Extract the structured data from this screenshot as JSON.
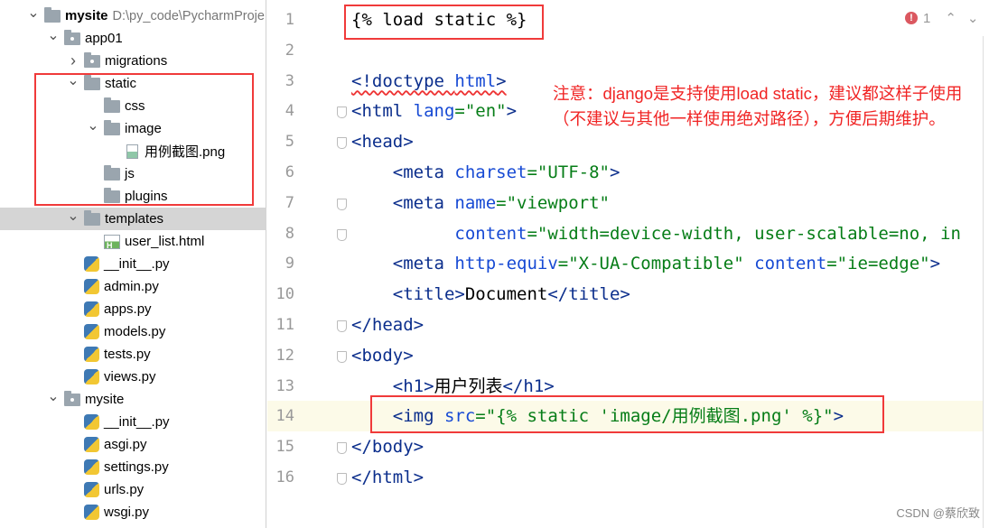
{
  "project_tree": [
    {
      "label": "mysite",
      "path": "D:\\py_code\\PycharmProje",
      "level": 0,
      "chevron": "down",
      "icon": "folder",
      "bold": true
    },
    {
      "label": "app01",
      "level": 1,
      "chevron": "down",
      "icon": "package-folder"
    },
    {
      "label": "migrations",
      "level": 2,
      "chevron": "right",
      "icon": "package-folder"
    },
    {
      "label": "static",
      "level": 2,
      "chevron": "down",
      "icon": "folder"
    },
    {
      "label": "css",
      "level": 3,
      "chevron": "",
      "icon": "folder"
    },
    {
      "label": "image",
      "level": 3,
      "chevron": "down",
      "icon": "folder"
    },
    {
      "label": "用例截图.png",
      "level": 4,
      "chevron": "",
      "icon": "image-file"
    },
    {
      "label": "js",
      "level": 3,
      "chevron": "",
      "icon": "folder"
    },
    {
      "label": "plugins",
      "level": 3,
      "chevron": "",
      "icon": "folder"
    },
    {
      "label": "templates",
      "level": 2,
      "chevron": "down",
      "icon": "folder",
      "selected": true
    },
    {
      "label": "user_list.html",
      "level": 3,
      "chevron": "",
      "icon": "html-file"
    },
    {
      "label": "__init__.py",
      "level": 2,
      "chevron": "",
      "icon": "python-file"
    },
    {
      "label": "admin.py",
      "level": 2,
      "chevron": "",
      "icon": "python-file"
    },
    {
      "label": "apps.py",
      "level": 2,
      "chevron": "",
      "icon": "python-file"
    },
    {
      "label": "models.py",
      "level": 2,
      "chevron": "",
      "icon": "python-file"
    },
    {
      "label": "tests.py",
      "level": 2,
      "chevron": "",
      "icon": "python-file"
    },
    {
      "label": "views.py",
      "level": 2,
      "chevron": "",
      "icon": "python-file"
    },
    {
      "label": "mysite",
      "level": 1,
      "chevron": "down",
      "icon": "package-folder"
    },
    {
      "label": "__init__.py",
      "level": 2,
      "chevron": "",
      "icon": "python-file"
    },
    {
      "label": "asgi.py",
      "level": 2,
      "chevron": "",
      "icon": "python-file"
    },
    {
      "label": "settings.py",
      "level": 2,
      "chevron": "",
      "icon": "python-file"
    },
    {
      "label": "urls.py",
      "level": 2,
      "chevron": "",
      "icon": "python-file"
    },
    {
      "label": "wsgi.py",
      "level": 2,
      "chevron": "",
      "icon": "python-file"
    }
  ],
  "editor": {
    "highlighted_line": 14,
    "lines": [
      {
        "n": "1",
        "tokens": [
          [
            "{% load static %}",
            "txt"
          ]
        ]
      },
      {
        "n": "2",
        "tokens": []
      },
      {
        "n": "3",
        "tokens": [
          [
            "<!doctype ",
            "tag-err"
          ],
          [
            "html",
            "attr-err"
          ],
          [
            ">",
            "tag-err"
          ]
        ]
      },
      {
        "n": "4",
        "fold": true,
        "tokens": [
          [
            "<html ",
            "tag"
          ],
          [
            "lang",
            "attr"
          ],
          [
            "=\"en\"",
            "str"
          ],
          [
            ">",
            "tag"
          ]
        ]
      },
      {
        "n": "5",
        "fold": true,
        "tokens": [
          [
            "<head>",
            "tag"
          ]
        ]
      },
      {
        "n": "6",
        "tokens": [
          [
            "    <meta ",
            "tag"
          ],
          [
            "charset",
            "attr"
          ],
          [
            "=\"UTF-8\"",
            "str"
          ],
          [
            ">",
            "tag"
          ]
        ]
      },
      {
        "n": "7",
        "fold": true,
        "tokens": [
          [
            "    <meta ",
            "tag"
          ],
          [
            "name",
            "attr"
          ],
          [
            "=\"viewport\"",
            "str"
          ]
        ]
      },
      {
        "n": "8",
        "fold": true,
        "tokens": [
          [
            "          ",
            "txt"
          ],
          [
            "content",
            "attr"
          ],
          [
            "=\"width=device-width, user-scalable=no, in",
            "str"
          ]
        ]
      },
      {
        "n": "9",
        "tokens": [
          [
            "    <meta ",
            "tag"
          ],
          [
            "http-equiv",
            "attr"
          ],
          [
            "=\"X-UA-Compatible\" ",
            "str"
          ],
          [
            "content",
            "attr"
          ],
          [
            "=\"ie=edge\"",
            "str"
          ],
          [
            ">",
            "tag"
          ]
        ]
      },
      {
        "n": "10",
        "tokens": [
          [
            "    <title>",
            "tag"
          ],
          [
            "Document",
            "txt"
          ],
          [
            "</title>",
            "tag"
          ]
        ]
      },
      {
        "n": "11",
        "fold": true,
        "tokens": [
          [
            "</head>",
            "tag"
          ]
        ]
      },
      {
        "n": "12",
        "fold": true,
        "tokens": [
          [
            "<body>",
            "tag"
          ]
        ]
      },
      {
        "n": "13",
        "tokens": [
          [
            "    <h1>",
            "tag"
          ],
          [
            "用户列表",
            "txt"
          ],
          [
            "</h1>",
            "tag"
          ]
        ]
      },
      {
        "n": "14",
        "tokens": [
          [
            "    <img ",
            "tag"
          ],
          [
            "src",
            "attr"
          ],
          [
            "=\"{% static 'image/用例截图.png' %}\"",
            "str"
          ],
          [
            ">",
            "tag"
          ]
        ]
      },
      {
        "n": "15",
        "fold": true,
        "tokens": [
          [
            "</body>",
            "tag"
          ]
        ]
      },
      {
        "n": "16",
        "fold": true,
        "tokens": [
          [
            "</html>",
            "tag"
          ]
        ]
      }
    ],
    "problems_count": "1",
    "annotation": "注意：django是支持使用load static，建议都这样子使用（不建议与其他一样使用绝对路径），方便后期维护。"
  },
  "watermark": "CSDN @蔡欣致",
  "colors": {
    "highlight_box": "#f03a3a",
    "annotation": "#f02424",
    "tag": "#0b2e8c",
    "attribute": "#174ad4",
    "string": "#067d17"
  }
}
